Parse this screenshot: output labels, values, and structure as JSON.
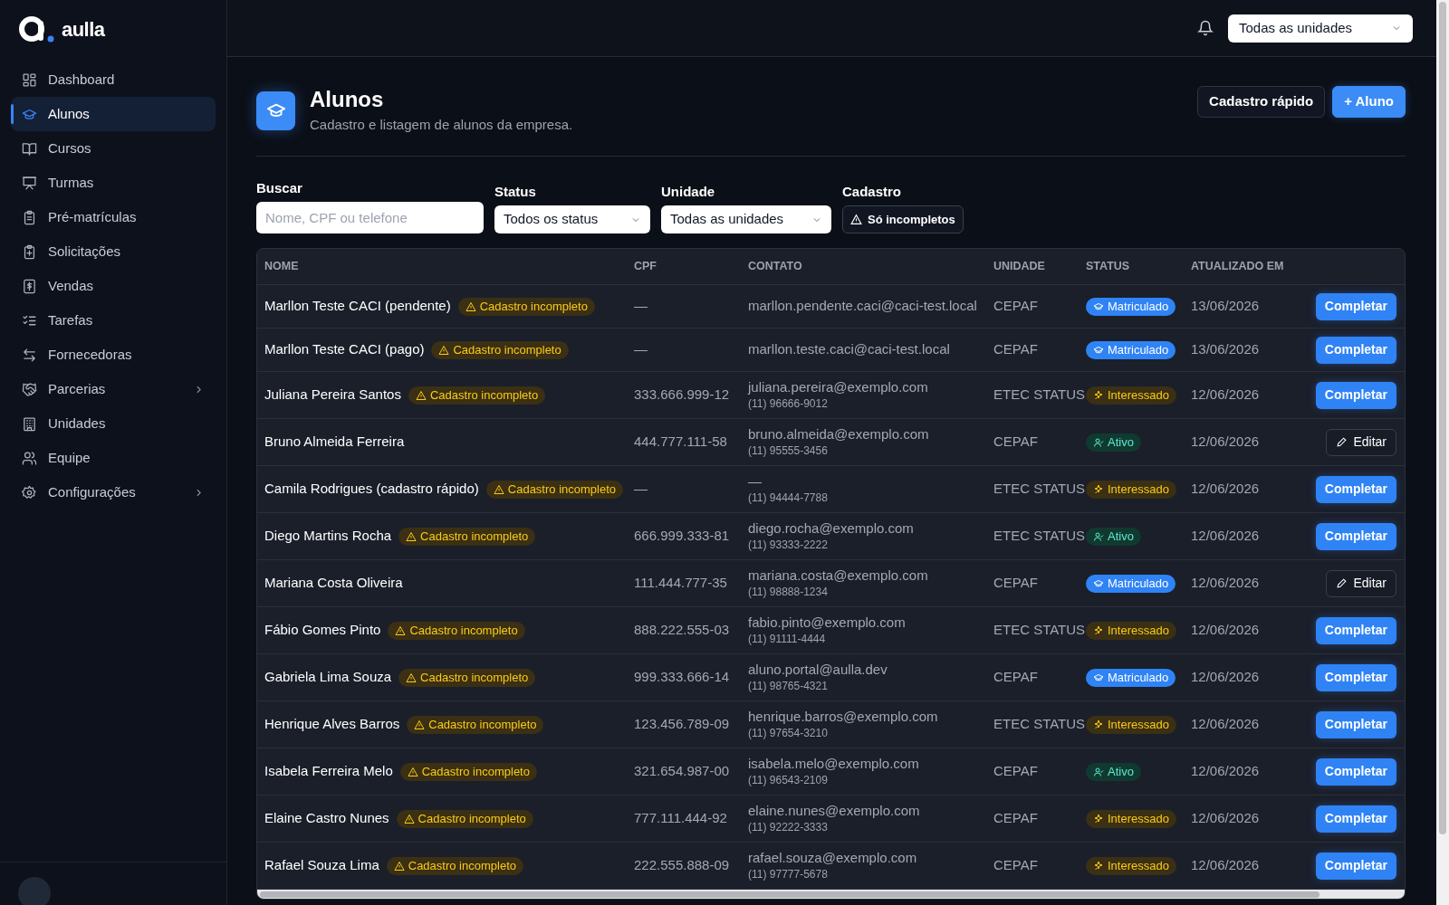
{
  "brand": {
    "name": "aulla"
  },
  "sidebar": {
    "items": [
      {
        "label": "Dashboard",
        "selected": false,
        "has_submenu": false
      },
      {
        "label": "Alunos",
        "selected": true,
        "has_submenu": false
      },
      {
        "label": "Cursos",
        "selected": false,
        "has_submenu": false
      },
      {
        "label": "Turmas",
        "selected": false,
        "has_submenu": false
      },
      {
        "label": "Pré-matrículas",
        "selected": false,
        "has_submenu": false
      },
      {
        "label": "Solicitações",
        "selected": false,
        "has_submenu": false
      },
      {
        "label": "Vendas",
        "selected": false,
        "has_submenu": false
      },
      {
        "label": "Tarefas",
        "selected": false,
        "has_submenu": false
      },
      {
        "label": "Fornecedoras",
        "selected": false,
        "has_submenu": false
      },
      {
        "label": "Parcerias",
        "selected": false,
        "has_submenu": true
      },
      {
        "label": "Unidades",
        "selected": false,
        "has_submenu": false
      },
      {
        "label": "Equipe",
        "selected": false,
        "has_submenu": false
      },
      {
        "label": "Configurações",
        "selected": false,
        "has_submenu": true
      }
    ]
  },
  "topbar": {
    "unit_select": "Todas as unidades"
  },
  "page": {
    "title": "Alunos",
    "subtitle": "Cadastro e listagem de alunos da empresa.",
    "buttons": [
      {
        "label": "Cadastro rápido",
        "kind": "secondary"
      },
      {
        "label": "+ Aluno",
        "kind": "primary"
      }
    ]
  },
  "filters": {
    "search": {
      "label": "Buscar",
      "placeholder": "Nome, CPF ou telefone"
    },
    "status": {
      "label": "Status",
      "value": "Todos os status"
    },
    "unit": {
      "label": "Unidade",
      "value": "Todas as unidades"
    },
    "cadastro": {
      "label": "Cadastro",
      "toggle": "Só incompletos",
      "on": false
    }
  },
  "table": {
    "columns": [
      "NOME",
      "CPF",
      "CONTATO",
      "UNIDADE",
      "STATUS",
      "ATUALIZADO EM"
    ],
    "rows": [
      {
        "name": "Marllon Teste CACI (pendente)",
        "badge": "Cadastro incompleto",
        "cpf": "—",
        "email": "marllon.pendente.caci@caci-test.local",
        "unit": "CEPAF",
        "status": {
          "kind": "matriculado",
          "label": "Matriculado"
        },
        "updated": "13/06/2026",
        "action": {
          "kind": "completar",
          "label": "Completar"
        }
      },
      {
        "name": "Marllon Teste CACI (pago)",
        "badge": "Cadastro incompleto",
        "cpf": "—",
        "email": "marllon.teste.caci@caci-test.local",
        "unit": "CEPAF",
        "status": {
          "kind": "matriculado",
          "label": "Matriculado"
        },
        "updated": "13/06/2026",
        "action": {
          "kind": "completar",
          "label": "Completar"
        }
      },
      {
        "name": "Juliana Pereira Santos",
        "badge": "Cadastro incompleto",
        "cpf": "333.666.999-12",
        "email": "juliana.pereira@exemplo.com",
        "phone": "(11) 96666-9012",
        "unit": "ETEC STATUS",
        "status": {
          "kind": "interessado",
          "label": "Interessado"
        },
        "updated": "12/06/2026",
        "action": {
          "kind": "completar",
          "label": "Completar"
        }
      },
      {
        "name": "Bruno Almeida Ferreira",
        "cpf": "444.777.111-58",
        "email": "bruno.almeida@exemplo.com",
        "phone": "(11) 95555-3456",
        "unit": "CEPAF",
        "status": {
          "kind": "ativo",
          "label": "Ativo"
        },
        "updated": "12/06/2026",
        "action": {
          "kind": "editar",
          "label": "Editar"
        }
      },
      {
        "name": "Camila Rodrigues (cadastro rápido)",
        "badge": "Cadastro incompleto",
        "cpf": "—",
        "email": "—",
        "phone": "(11) 94444-7788",
        "unit": "ETEC STATUS",
        "status": {
          "kind": "interessado",
          "label": "Interessado"
        },
        "updated": "12/06/2026",
        "action": {
          "kind": "completar",
          "label": "Completar"
        }
      },
      {
        "name": "Diego Martins Rocha",
        "badge": "Cadastro incompleto",
        "cpf": "666.999.333-81",
        "email": "diego.rocha@exemplo.com",
        "phone": "(11) 93333-2222",
        "unit": "ETEC STATUS",
        "status": {
          "kind": "ativo",
          "label": "Ativo"
        },
        "updated": "12/06/2026",
        "action": {
          "kind": "completar",
          "label": "Completar"
        }
      },
      {
        "name": "Mariana Costa Oliveira",
        "cpf": "111.444.777-35",
        "email": "mariana.costa@exemplo.com",
        "phone": "(11) 98888-1234",
        "unit": "CEPAF",
        "status": {
          "kind": "matriculado",
          "label": "Matriculado"
        },
        "updated": "12/06/2026",
        "action": {
          "kind": "editar",
          "label": "Editar"
        }
      },
      {
        "name": "Fábio Gomes Pinto",
        "badge": "Cadastro incompleto",
        "cpf": "888.222.555-03",
        "email": "fabio.pinto@exemplo.com",
        "phone": "(11) 91111-4444",
        "unit": "ETEC STATUS",
        "status": {
          "kind": "interessado",
          "label": "Interessado"
        },
        "updated": "12/06/2026",
        "action": {
          "kind": "completar",
          "label": "Completar"
        }
      },
      {
        "name": "Gabriela Lima Souza",
        "badge": "Cadastro incompleto",
        "cpf": "999.333.666-14",
        "email": "aluno.portal@aulla.dev",
        "phone": "(11) 98765-4321",
        "unit": "CEPAF",
        "status": {
          "kind": "matriculado",
          "label": "Matriculado"
        },
        "updated": "12/06/2026",
        "action": {
          "kind": "completar",
          "label": "Completar"
        }
      },
      {
        "name": "Henrique Alves Barros",
        "badge": "Cadastro incompleto",
        "cpf": "123.456.789-09",
        "email": "henrique.barros@exemplo.com",
        "phone": "(11) 97654-3210",
        "unit": "ETEC STATUS",
        "status": {
          "kind": "interessado",
          "label": "Interessado"
        },
        "updated": "12/06/2026",
        "action": {
          "kind": "completar",
          "label": "Completar"
        }
      },
      {
        "name": "Isabela Ferreira Melo",
        "badge": "Cadastro incompleto",
        "cpf": "321.654.987-00",
        "email": "isabela.melo@exemplo.com",
        "phone": "(11) 96543-2109",
        "unit": "CEPAF",
        "status": {
          "kind": "ativo",
          "label": "Ativo"
        },
        "updated": "12/06/2026",
        "action": {
          "kind": "completar",
          "label": "Completar"
        }
      },
      {
        "name": "Elaine Castro Nunes",
        "badge": "Cadastro incompleto",
        "cpf": "777.111.444-92",
        "email": "elaine.nunes@exemplo.com",
        "phone": "(11) 92222-3333",
        "unit": "CEPAF",
        "status": {
          "kind": "interessado",
          "label": "Interessado"
        },
        "updated": "12/06/2026",
        "action": {
          "kind": "completar",
          "label": "Completar"
        }
      },
      {
        "name": "Rafael Souza Lima",
        "badge": "Cadastro incompleto",
        "cpf": "222.555.888-09",
        "email": "rafael.souza@exemplo.com",
        "phone": "(11) 97777-5678",
        "unit": "CEPAF",
        "status": {
          "kind": "interessado",
          "label": "Interessado"
        },
        "updated": "12/06/2026",
        "action": {
          "kind": "completar",
          "label": "Completar"
        }
      }
    ]
  }
}
